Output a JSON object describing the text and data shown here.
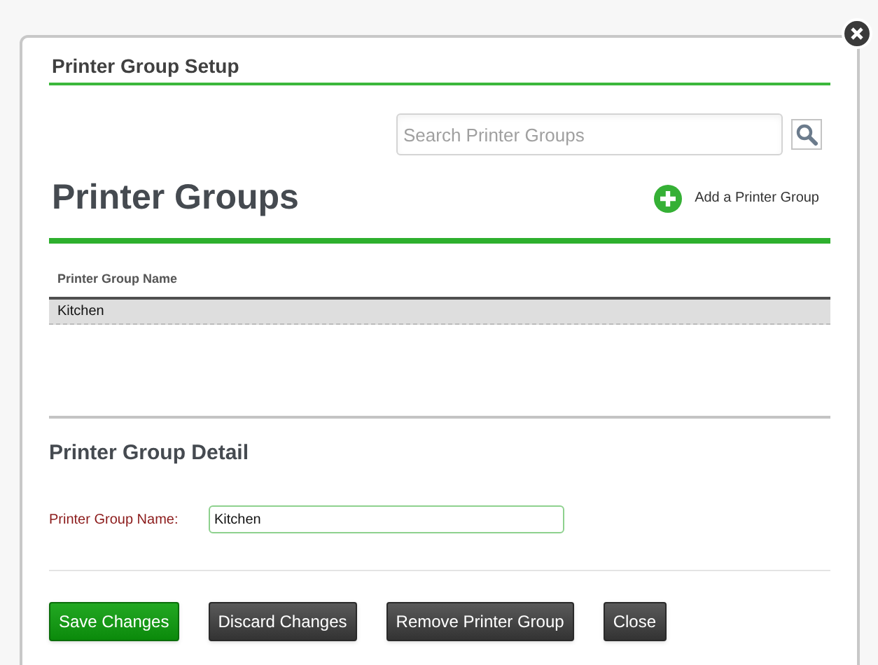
{
  "dialog": {
    "title": "Printer Group Setup"
  },
  "search": {
    "placeholder": "Search Printer Groups"
  },
  "heading": "Printer Groups",
  "add_link": "Add a Printer Group",
  "table": {
    "columns": [
      "Printer Group Name"
    ],
    "rows": [
      {
        "cells": [
          "Kitchen"
        ],
        "selected": true
      }
    ]
  },
  "detail": {
    "heading": "Printer Group Detail",
    "label": "Printer Group Name:",
    "value": "Kitchen"
  },
  "buttons": [
    {
      "label": "Save Changes",
      "kind": "primary"
    },
    {
      "label": "Discard Changes",
      "kind": "secondary"
    },
    {
      "label": "Remove Printer Group",
      "kind": "secondary"
    },
    {
      "label": "Close",
      "kind": "secondary"
    }
  ]
}
